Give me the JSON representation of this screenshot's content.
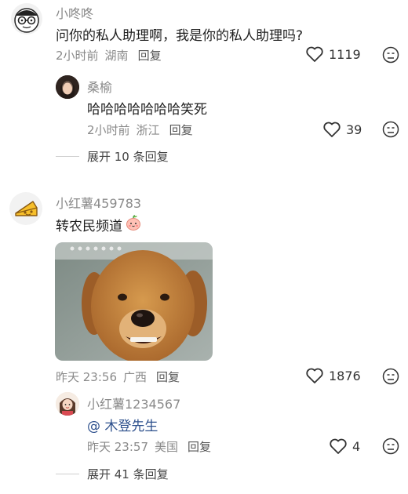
{
  "comments": [
    {
      "name": "小咚咚",
      "text": "问你的私人助理啊，我是你的私人助理吗?",
      "time": "2小时前",
      "location": "湖南",
      "reply_label": "回复",
      "likes": "1119",
      "avatar_icon": "cartoon-glasses-face",
      "replies": [
        {
          "name": "桑榆",
          "text": "哈哈哈哈哈哈哈笑死",
          "time": "2小时前",
          "location": "浙江",
          "reply_label": "回复",
          "likes": "39",
          "avatar_icon": "girl-portrait"
        }
      ],
      "expand_label": "展开 10 条回复"
    },
    {
      "name": "小红薯459783",
      "text": "转农民频道",
      "emoji_icon": "peach-face-emoji",
      "image_icon": "smiling-golden-retriever-photo",
      "time": "昨天 23:56",
      "location": "广西",
      "reply_label": "回复",
      "likes": "1876",
      "avatar_icon": "cheese-icon",
      "replies": [
        {
          "name": "小红薯1234567",
          "mention": "@ 木登先生",
          "time": "昨天 23:57",
          "location": "美国",
          "reply_label": "回复",
          "likes": "4",
          "avatar_icon": "cartoon-girl-portrait"
        }
      ],
      "expand_label": "展开 41 条回复"
    }
  ],
  "colors": {
    "meta": "#8a8a8a",
    "mention": "#2c4f8c"
  }
}
